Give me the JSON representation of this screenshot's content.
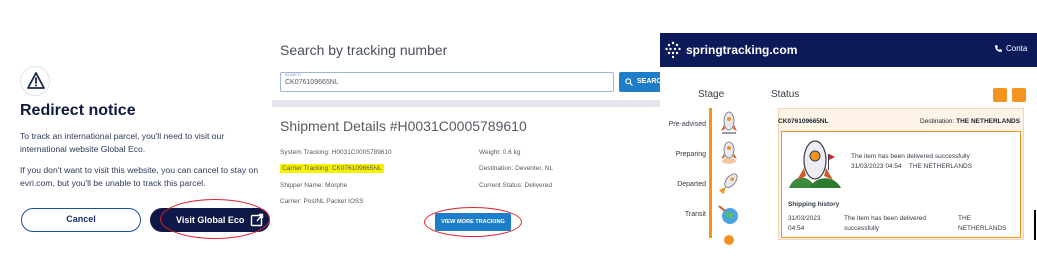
{
  "redirect": {
    "title": "Redirect notice",
    "paragraph1": "To track an international parcel, you'll need to visit our international website Global Eco.",
    "paragraph2": "If you don't want to visit this website, you can cancel to stay on evri.com, but you'll be unable to track this parcel.",
    "cancel_label": "Cancel",
    "visit_label": "Visit Global Eco"
  },
  "search": {
    "title": "Search by tracking number",
    "field_label": "SEARCH",
    "value": "CK076109665NL",
    "button_label": "SEARCH",
    "shipment_title": "Shipment Details #H0031C0005789610",
    "system_tracking": "System Tracking: H0031C0005789610",
    "carrier_tracking": "Carrier Tracking: CK076109665NL",
    "shipper_name": "Shipper Name: Morphe",
    "carrier": "Carrier: PostNL Packet IOSS",
    "weight": "Weight: 0.6 kg",
    "destination": "Destination: Deventer, NL",
    "current_status": "Current Status: Delivered",
    "more_button": "VIEW MORE TRACKING"
  },
  "spring": {
    "brand": "springtracking.com",
    "contact": "Conta",
    "stage_header": "Stage",
    "status_header": "Status",
    "stages": [
      "Pre-advised",
      "Preparing",
      "Departed",
      "Transit"
    ],
    "tracking_id": "CK076109665NL",
    "destination_label": "Destination:",
    "destination_value": "THE NETHERLANDS",
    "status_message": "The item has been delivered successfully",
    "status_datetime": "31/03/2023 04:54",
    "status_place": "THE NETHERLANDS",
    "history_title": "Shipping history",
    "history_date": "31/03/2023",
    "history_time": "04:54",
    "history_event_1": "The item has been delivered",
    "history_event_2": "successfully",
    "history_place_1": "THE",
    "history_place_2": "NETHERLANDS"
  },
  "colors": {
    "navy": "#0d1846",
    "search_blue": "#1f7ec9",
    "spring_navy": "#0d1a5a",
    "orange": "#f2941f",
    "highlight": "#f6f200",
    "annotation_red": "#e0202a"
  }
}
